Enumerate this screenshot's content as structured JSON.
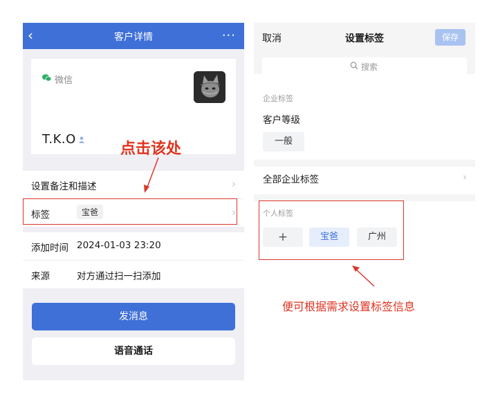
{
  "left": {
    "nav": {
      "title": "客户详情",
      "back": "‹",
      "more": "···"
    },
    "card": {
      "source_app": "微信",
      "name": "T.K.O"
    },
    "rows": {
      "remark": {
        "label": "设置备注和描述"
      },
      "tags": {
        "label": "标签",
        "tag": "宝爸"
      },
      "added_time": {
        "label": "添加时间",
        "value": "2024-01-03 23:20"
      },
      "source": {
        "label": "来源",
        "value": "对方通过扫一扫添加"
      }
    },
    "buttons": {
      "send_message": "发消息",
      "voice_call": "语音通话"
    }
  },
  "right": {
    "header": {
      "cancel": "取消",
      "title": "设置标签",
      "save": "保存"
    },
    "search": {
      "placeholder": "搜索"
    },
    "enterprise": {
      "section_label": "企业标签",
      "group_title": "客户等级",
      "tags": [
        "一般"
      ],
      "all_tags_label": "全部企业标签"
    },
    "personal": {
      "section_label": "个人标签",
      "add_symbol": "+",
      "tags": [
        "宝爸",
        "广州"
      ]
    }
  },
  "annotations": {
    "click_here": "点击该处",
    "hint": "便可根据需求设置标签信息",
    "color": "#e0321f"
  },
  "colors": {
    "brand_blue": "#3f70d8",
    "save_disabled": "#a9c3f1",
    "wechat_green": "#2aae67"
  }
}
